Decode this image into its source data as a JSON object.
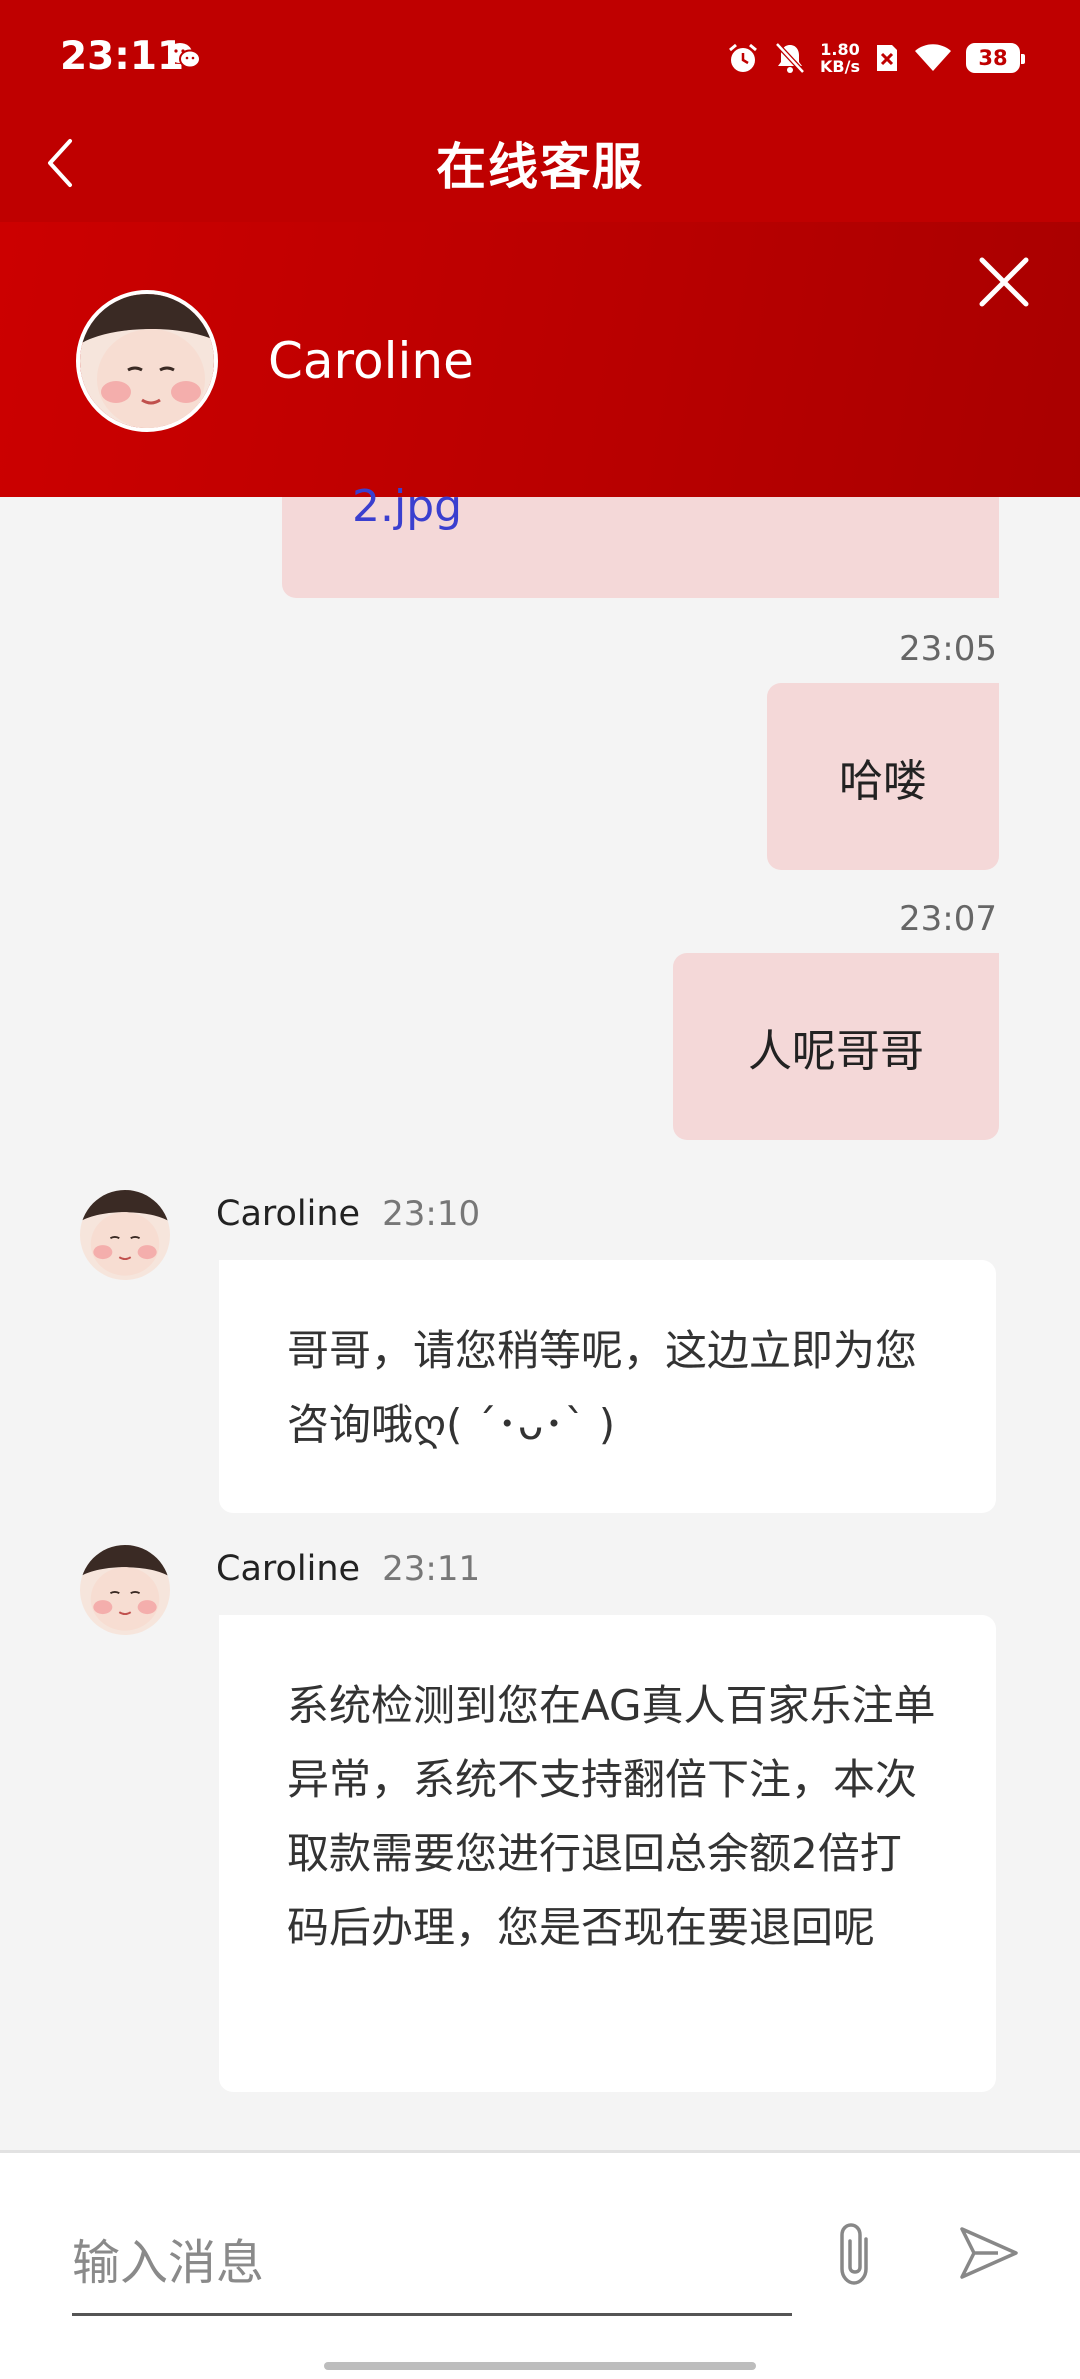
{
  "status_bar": {
    "time": "23:11",
    "net_speed_value": "1.80",
    "net_speed_unit": "KB/s",
    "battery": "38"
  },
  "nav": {
    "title": "在线客服"
  },
  "agent": {
    "name": "Caroline"
  },
  "messages": {
    "file_name": "2.jpg",
    "out1": {
      "time": "23:05",
      "text": "哈喽"
    },
    "out2": {
      "time": "23:07",
      "text": "人呢哥哥"
    },
    "in1": {
      "sender": "Caroline",
      "time": "23:10",
      "text": "哥哥，请您稍等呢，这边立即为您咨询哦ღ( ´･ᴗ･` )"
    },
    "in2": {
      "sender": "Caroline",
      "time": "23:11",
      "text": "系统检测到您在AG真人百家乐注单异常，系统不支持翻倍下注，本次取款需要您进行退回总余额2倍打码后办理，您是否现在要退回呢"
    }
  },
  "composer": {
    "placeholder": "输入消息"
  },
  "colors": {
    "header": "#bf0000",
    "outgoing_bubble": "#f4d8d8",
    "link": "#3a3fcf"
  }
}
